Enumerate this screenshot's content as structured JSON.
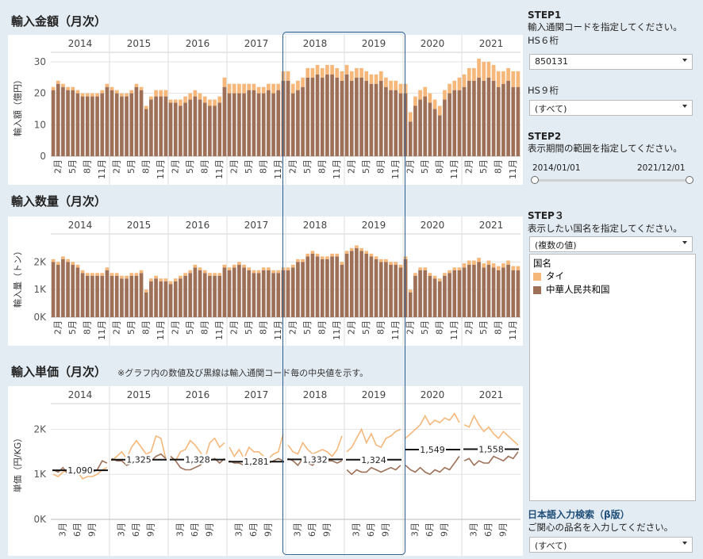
{
  "panels": {
    "amount_title": "輸入金額（月次）",
    "quantity_title": "輸入数量（月次）",
    "price_title": "輸入単価（月次）",
    "price_note": "※グラフ内の数値及び黒線は輸入通関コード毎の中央値を示す。"
  },
  "colors": {
    "thai": "#f5b77a",
    "china": "#9e7058",
    "grid": "#e3e3e3",
    "median": "#111111"
  },
  "sidebar": {
    "step1_heading": "STEP1",
    "step1_desc": "輸入通関コードを指定してください。",
    "hs6_label": "HS６桁",
    "hs6_value": "850131",
    "hs9_label": "HS９桁",
    "hs9_value": "(すべて)",
    "step2_heading": "STEP2",
    "step2_desc": "表示期間の範囲を指定してください。",
    "date_start": "2014/01/01",
    "date_end": "2021/12/01",
    "step3_heading": "STEP３",
    "step3_desc": "表示したい国名を指定してください。",
    "country_value": "(複数の値)",
    "legend_title": "国名",
    "legend_items": [
      "タイ",
      "中華人民共和国"
    ],
    "search_heading": "日本語入力検索（β版）",
    "search_desc": "ご関心の品名を入力してください。",
    "search_value": "(すべて)"
  },
  "chart_data": [
    {
      "type": "bar",
      "title": "輸入金額（月次）",
      "ylabel": "輸入額（億円）",
      "ylim": [
        0,
        32
      ],
      "yticks": [
        "0",
        "10",
        "20",
        "30"
      ],
      "years": [
        "2014",
        "2015",
        "2016",
        "2017",
        "2018",
        "2019",
        "2020",
        "2021"
      ],
      "month_ticks": [
        "2月",
        "5月",
        "8月",
        "11月"
      ],
      "series": [
        {
          "name": "中華人民共和国",
          "values": [
            21,
            23,
            22,
            21,
            21,
            20,
            19,
            19,
            19,
            19,
            20,
            22,
            21,
            20,
            19,
            19,
            20,
            22,
            21,
            15,
            18,
            19,
            19,
            19,
            17,
            17,
            16,
            17,
            18,
            19,
            18,
            17,
            16,
            16,
            17,
            22,
            20,
            20,
            20,
            20,
            21,
            21,
            20,
            20,
            21,
            20,
            21,
            24,
            24,
            20,
            21,
            22,
            25,
            25,
            26,
            25,
            26,
            26,
            25,
            24,
            26,
            24,
            25,
            25,
            24,
            23,
            23,
            24,
            22,
            21,
            21,
            20,
            20,
            11,
            16,
            18,
            19,
            17,
            15,
            13,
            18,
            20,
            21,
            21,
            22,
            24,
            24,
            25,
            24,
            25,
            24,
            22,
            23,
            24,
            22,
            22
          ]
        },
        {
          "name": "タイ",
          "values": [
            1,
            1,
            1,
            1,
            1,
            1,
            1,
            1,
            1,
            1,
            1,
            1,
            1,
            1,
            1,
            1,
            1,
            1,
            1,
            1,
            1,
            2,
            2,
            2,
            1,
            1,
            2,
            2,
            2,
            2,
            2,
            2,
            2,
            2,
            2,
            3,
            3,
            3,
            3,
            3,
            2,
            2,
            2,
            2,
            2,
            3,
            2,
            3,
            3,
            3,
            3,
            3,
            3,
            3,
            3,
            3,
            3,
            3,
            3,
            3,
            3,
            3,
            3,
            3,
            3,
            3,
            3,
            3,
            3,
            3,
            3,
            3,
            3,
            3,
            3,
            3,
            3,
            3,
            3,
            3,
            3,
            3,
            3,
            4,
            4,
            4,
            4,
            6,
            6,
            5,
            5,
            5,
            4,
            4,
            5,
            5
          ]
        }
      ]
    },
    {
      "type": "bar",
      "title": "輸入数量（月次）",
      "ylabel": "輸入量（トン）",
      "ylim": [
        0,
        2900
      ],
      "yticks": [
        "0K",
        "1K",
        "2K"
      ],
      "years": [
        "2014",
        "2015",
        "2016",
        "2017",
        "2018",
        "2019",
        "2020",
        "2021"
      ],
      "month_ticks": [
        "2月",
        "5月",
        "8月",
        "11月"
      ],
      "series": [
        {
          "name": "中華人民共和国",
          "values": [
            2000,
            1900,
            2100,
            2000,
            1900,
            1800,
            1600,
            1500,
            1500,
            1500,
            1500,
            1700,
            1500,
            1500,
            1400,
            1400,
            1500,
            1500,
            1600,
            900,
            1300,
            1400,
            1300,
            1300,
            1200,
            1300,
            1400,
            1500,
            1600,
            1800,
            1700,
            1600,
            1500,
            1500,
            1500,
            1800,
            1700,
            1800,
            1900,
            1800,
            1700,
            1600,
            1600,
            1700,
            1700,
            1600,
            1600,
            1700,
            1700,
            1800,
            2000,
            2000,
            2200,
            2300,
            2200,
            2100,
            2100,
            2200,
            2200,
            1900,
            2300,
            2400,
            2500,
            2400,
            2300,
            2200,
            2100,
            2000,
            2000,
            1900,
            1900,
            1800,
            2100,
            900,
            1500,
            1700,
            1700,
            1500,
            1400,
            1300,
            1500,
            1600,
            1700,
            1700,
            1800,
            1900,
            1900,
            2000,
            1800,
            1900,
            1800,
            1700,
            1800,
            1900,
            1700,
            1700
          ]
        },
        {
          "name": "タイ",
          "values": [
            100,
            100,
            100,
            100,
            100,
            100,
            100,
            100,
            100,
            100,
            100,
            100,
            100,
            100,
            100,
            100,
            100,
            100,
            100,
            100,
            100,
            100,
            100,
            100,
            100,
            100,
            100,
            100,
            100,
            100,
            100,
            100,
            100,
            100,
            100,
            100,
            100,
            100,
            100,
            100,
            100,
            100,
            100,
            100,
            100,
            100,
            100,
            100,
            100,
            100,
            100,
            100,
            100,
            100,
            100,
            100,
            100,
            100,
            100,
            100,
            100,
            100,
            100,
            100,
            100,
            100,
            100,
            100,
            100,
            100,
            100,
            100,
            100,
            100,
            100,
            100,
            100,
            100,
            100,
            100,
            100,
            100,
            100,
            100,
            150,
            150,
            150,
            150,
            150,
            150,
            150,
            150,
            150,
            150,
            150,
            150
          ]
        }
      ]
    },
    {
      "type": "line",
      "title": "輸入単価（月次）",
      "ylabel": "単価（円/KG）",
      "ylim": [
        0,
        2500
      ],
      "yticks": [
        "0K",
        "1K",
        "2K"
      ],
      "years": [
        "2014",
        "2015",
        "2016",
        "2017",
        "2018",
        "2019",
        "2020",
        "2021"
      ],
      "month_ticks": [
        "3月",
        "6月",
        "9月"
      ],
      "medians": [
        {
          "year": "2014",
          "value": 1090,
          "label": "1,090"
        },
        {
          "year": "2015",
          "value": 1325,
          "label": "1,325"
        },
        {
          "year": "2016",
          "value": 1328,
          "label": "1,328"
        },
        {
          "year": "2017",
          "value": 1281,
          "label": "1,281"
        },
        {
          "year": "2018",
          "value": 1332,
          "label": "1,332"
        },
        {
          "year": "2019",
          "value": 1324,
          "label": "1,324"
        },
        {
          "year": "2020",
          "value": 1549,
          "label": "1,549"
        },
        {
          "year": "2021",
          "value": 1558,
          "label": "1,558"
        }
      ],
      "series": [
        {
          "name": "タイ",
          "values": [
            1000,
            950,
            1050,
            1100,
            1000,
            1050,
            900,
            950,
            950,
            1000,
            1100,
            1150,
            1300,
            1400,
            1500,
            1350,
            1600,
            1750,
            1600,
            1450,
            1500,
            1850,
            1800,
            1350,
            1400,
            1300,
            1500,
            1550,
            1750,
            1650,
            1500,
            1350,
            1700,
            1800,
            1600,
            1700,
            1600,
            1400,
            1550,
            1350,
            1600,
            1500,
            1500,
            1400,
            1350,
            1450,
            1500,
            1900,
            1650,
            1500,
            1450,
            1700,
            1550,
            1450,
            1500,
            1550,
            1500,
            1400,
            1550,
            1850,
            1500,
            1600,
            1800,
            2000,
            1700,
            1900,
            1650,
            1600,
            1800,
            1850,
            1950,
            2000,
            1800,
            1900,
            2000,
            2100,
            2300,
            2100,
            2200,
            2150,
            2250,
            2200,
            2350,
            2150,
            2100,
            2050,
            2300,
            2100,
            1950,
            2050,
            1900,
            1800,
            1950,
            1850,
            1750,
            1650
          ]
        },
        {
          "name": "中華人民共和国",
          "values": [
            1100,
            1050,
            1150,
            1000,
            1050,
            1100,
            1000,
            1100,
            1050,
            1100,
            1300,
            1250,
            1350,
            1300,
            1300,
            1200,
            1250,
            1300,
            1350,
            1350,
            1300,
            1400,
            1450,
            1350,
            1400,
            1300,
            1150,
            1100,
            1100,
            1150,
            1200,
            1300,
            1300,
            1350,
            1250,
            1350,
            1300,
            1250,
            1250,
            1200,
            1300,
            1250,
            1250,
            1300,
            1250,
            1300,
            1350,
            1300,
            1350,
            1300,
            1200,
            1350,
            1250,
            1200,
            1300,
            1250,
            1300,
            1300,
            1250,
            1300,
            1100,
            1000,
            1100,
            1050,
            1050,
            1150,
            1100,
            1050,
            1100,
            1150,
            1100,
            1200,
            1200,
            1100,
            1050,
            1150,
            1050,
            1000,
            1100,
            1050,
            1150,
            1100,
            1250,
            1400,
            1300,
            1350,
            1200,
            1300,
            1250,
            1250,
            1400,
            1350,
            1300,
            1400,
            1350,
            1500
          ]
        }
      ]
    }
  ]
}
